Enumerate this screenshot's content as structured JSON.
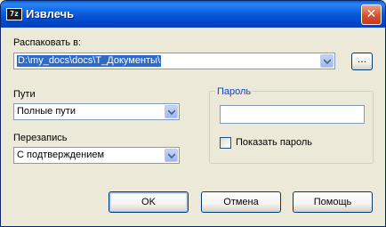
{
  "window": {
    "title": "Извлечь",
    "app_icon_text": "7z",
    "close_glyph": "✕"
  },
  "extract_to": {
    "label": "Распаковать в:",
    "value": "D:\\my_docs\\docs\\Т_Документы\\",
    "browse_label": "..."
  },
  "paths": {
    "label": "Пути",
    "value": "Полные пути"
  },
  "overwrite": {
    "label": "Перезапись",
    "value": "С подтверждением"
  },
  "password": {
    "group_label": "Пароль",
    "value": "",
    "show_label": "Показать пароль",
    "show_checked": false
  },
  "buttons": {
    "ok": "OK",
    "cancel": "Отмена",
    "help": "Помощь"
  },
  "colors": {
    "title_bar": "#0a5fd8",
    "dialog_bg": "#ece9d8",
    "group_label": "#0046d5",
    "selection": "#316ac5"
  }
}
